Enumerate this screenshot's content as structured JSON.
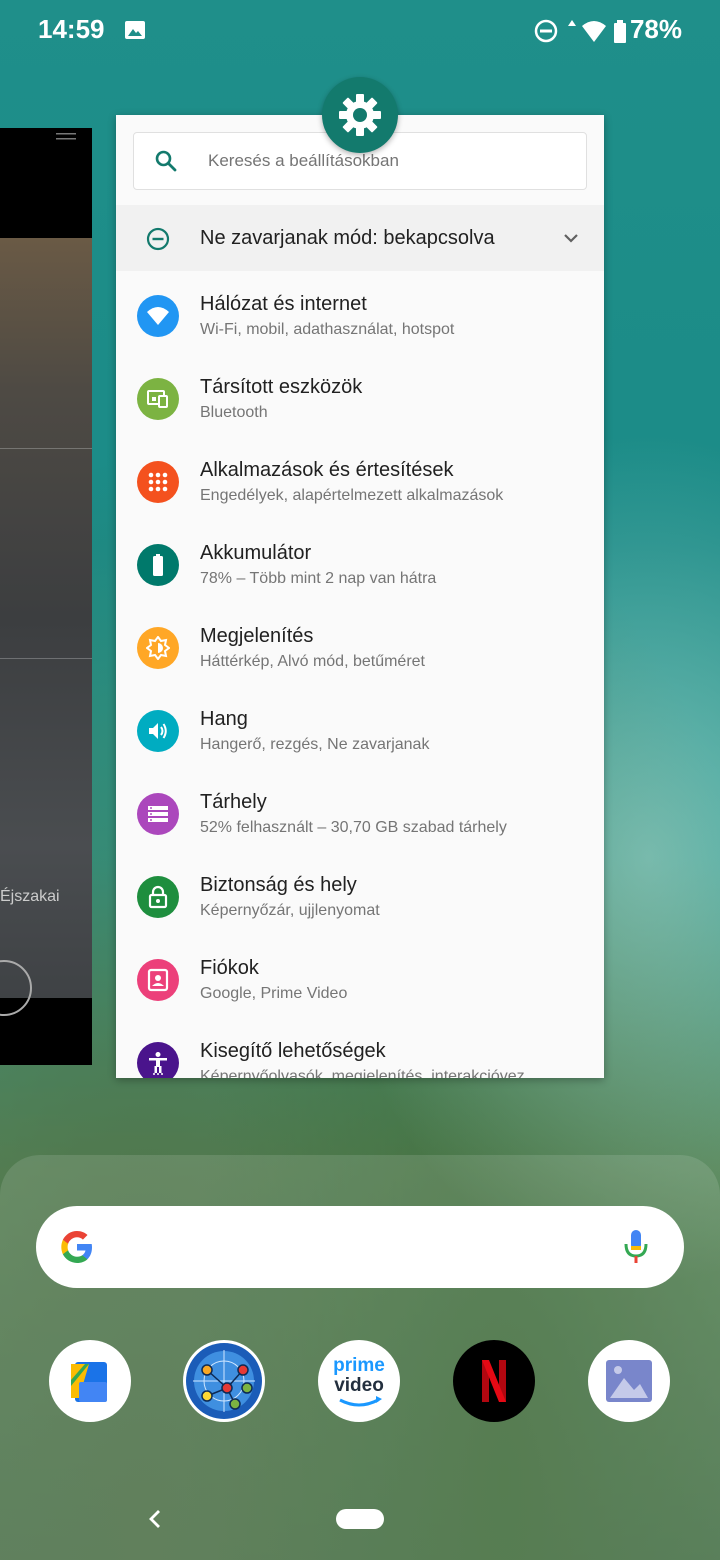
{
  "status_bar": {
    "time": "14:59",
    "battery": "78%",
    "icons": [
      "image-icon",
      "do-not-disturb-icon",
      "wifi-icon",
      "battery-icon"
    ]
  },
  "left_card": {
    "label": "Éjszakai"
  },
  "settings": {
    "search_placeholder": "Keresés a beállításokban",
    "dnd_label": "Ne zavarjanak mód: bekapcsolva",
    "items": [
      {
        "title": "Hálózat és internet",
        "subtitle": "Wi-Fi, mobil, adathasználat, hotspot",
        "color": "#2196f3",
        "icon": "wifi-icon"
      },
      {
        "title": "Társított eszközök",
        "subtitle": "Bluetooth",
        "color": "#7cb342",
        "icon": "devices-icon"
      },
      {
        "title": "Alkalmazások és értesítések",
        "subtitle": "Engedélyek, alapértelmezett alkalmazások",
        "color": "#f4511e",
        "icon": "apps-grid-icon"
      },
      {
        "title": "Akkumulátor",
        "subtitle": "78% – Több mint 2 nap van hátra",
        "color": "#00796b",
        "icon": "battery-icon"
      },
      {
        "title": "Megjelenítés",
        "subtitle": "Háttérkép, Alvó mód, betűméret",
        "color": "#ffa726",
        "icon": "brightness-icon"
      },
      {
        "title": "Hang",
        "subtitle": "Hangerő, rezgés, Ne zavarjanak",
        "color": "#00acc1",
        "icon": "volume-icon"
      },
      {
        "title": "Tárhely",
        "subtitle": "52% felhasznált – 30,70 GB szabad tárhely",
        "color": "#ab47bc",
        "icon": "storage-icon"
      },
      {
        "title": "Biztonság és hely",
        "subtitle": "Képernyőzár, ujjlenyomat",
        "color": "#1e8e3e",
        "icon": "lock-icon"
      },
      {
        "title": "Fiókok",
        "subtitle": "Google, Prime Video",
        "color": "#ec407a",
        "icon": "account-icon"
      },
      {
        "title": "Kisegítő lehetőségek",
        "subtitle": "Képernyőolvasók, megjelenítés, interakcióvez",
        "color": "#4a148c",
        "icon": "accessibility-icon"
      }
    ]
  },
  "dock": {
    "prime_line1": "prime",
    "prime_line2": "video",
    "apps": [
      "files-app-icon",
      "network-app-icon",
      "prime-video-app-icon",
      "netflix-app-icon",
      "gallery-app-icon"
    ]
  }
}
